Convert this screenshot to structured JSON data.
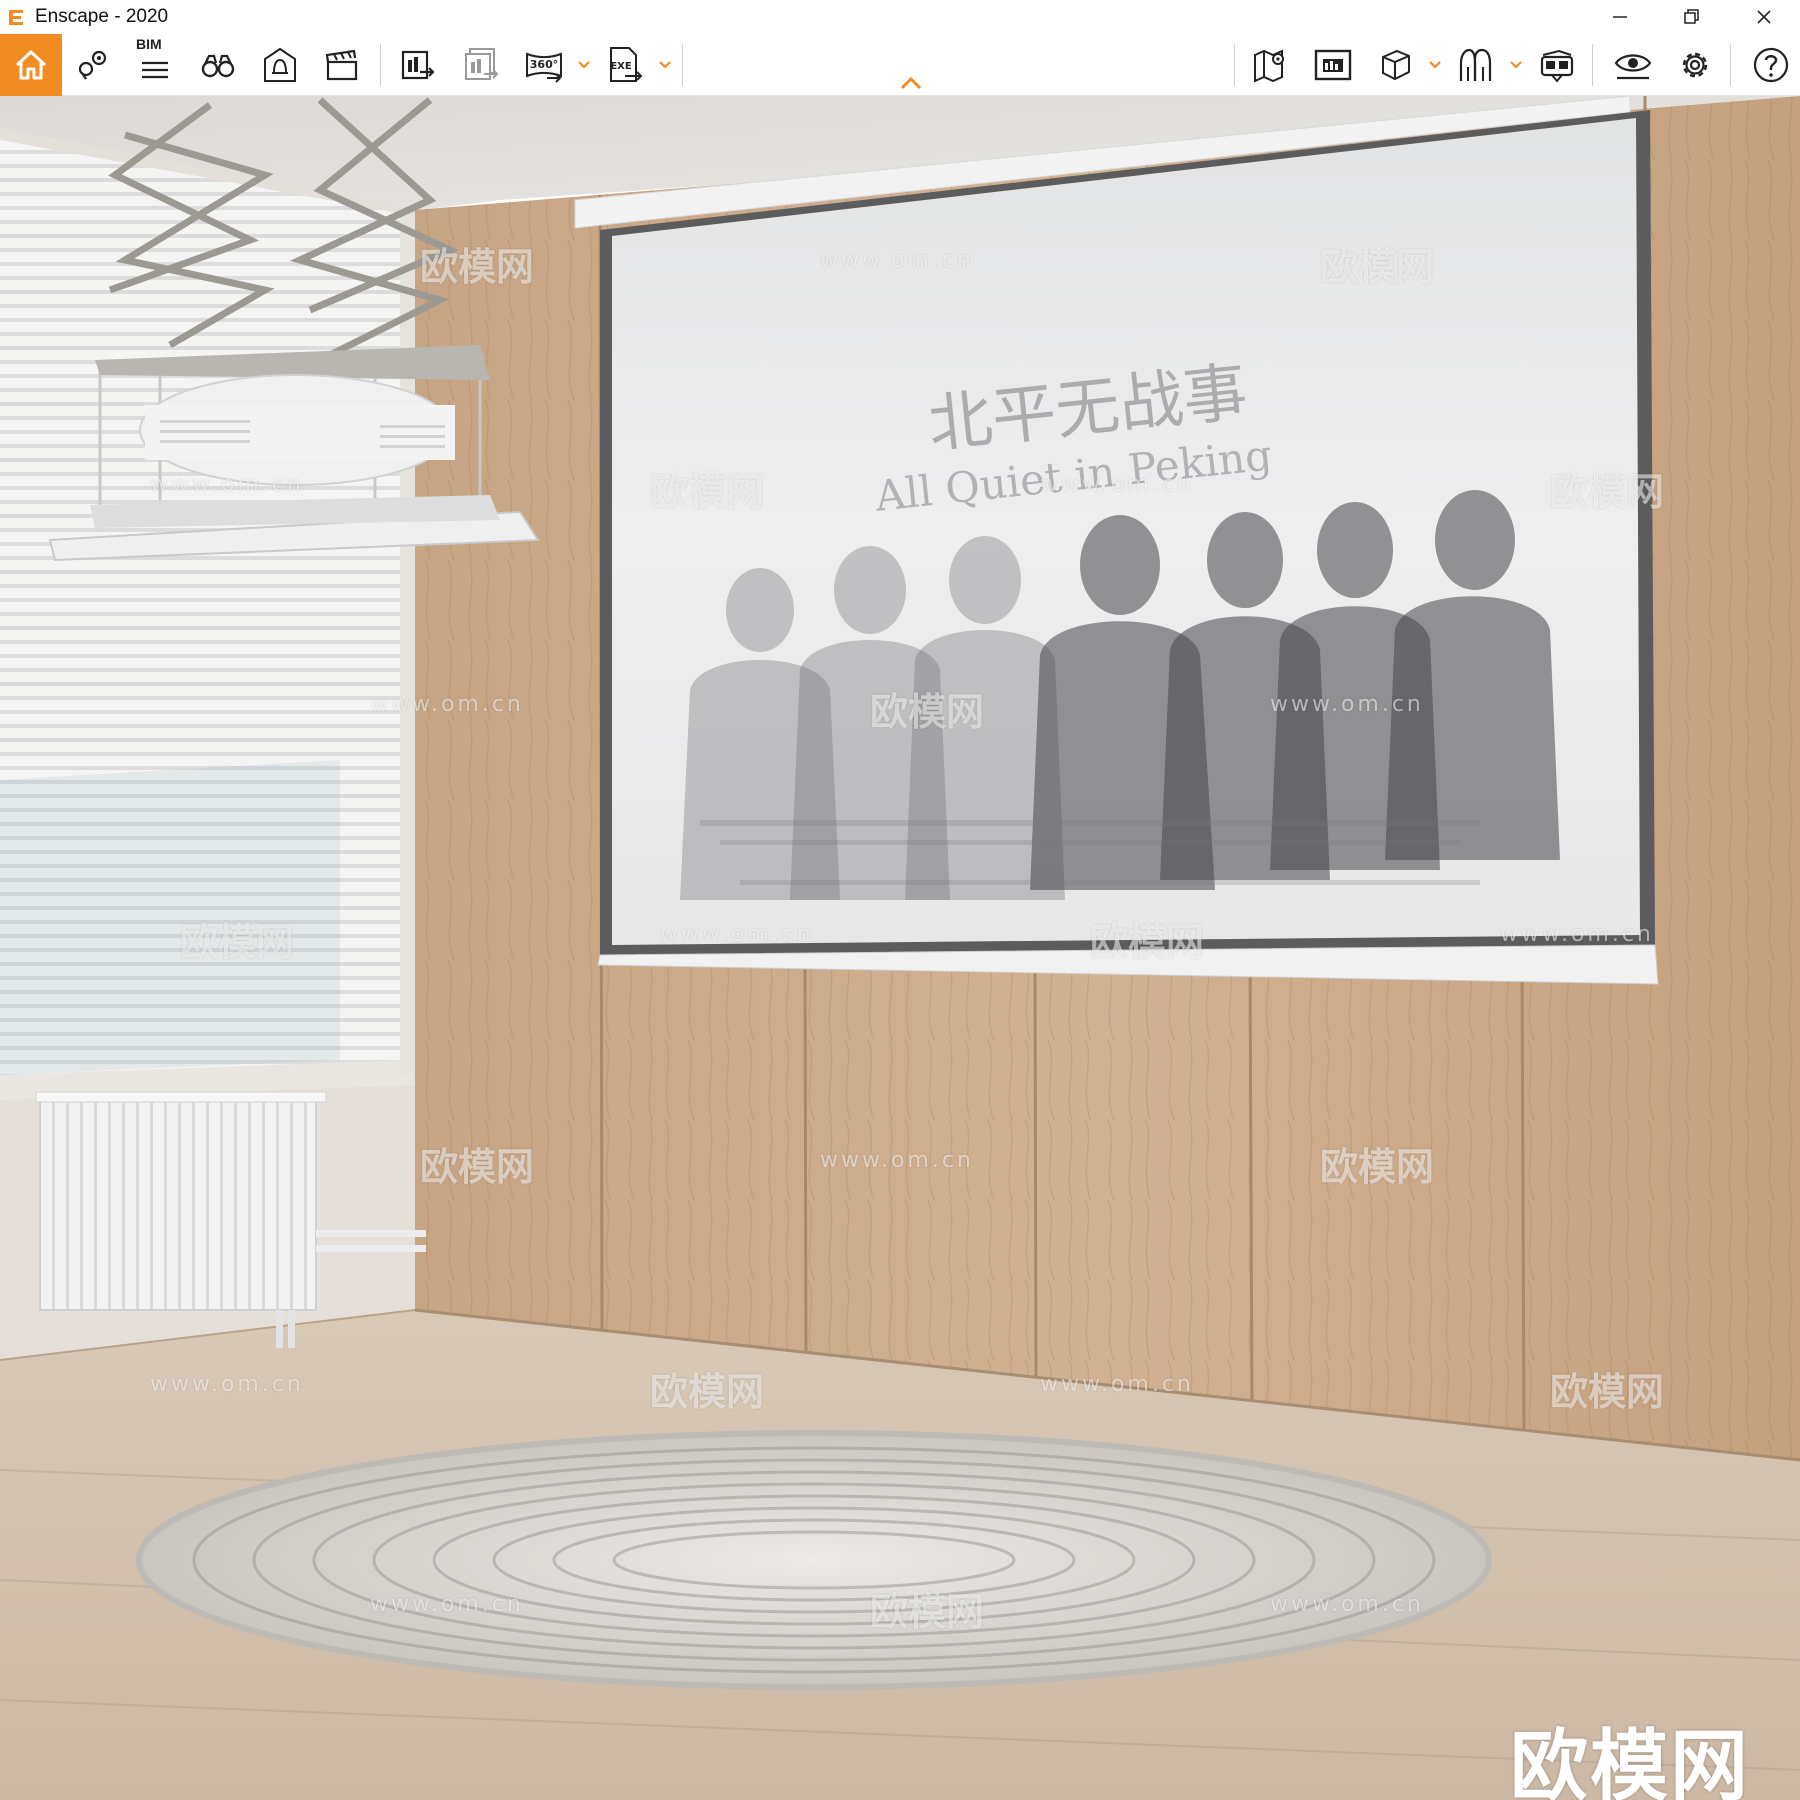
{
  "window": {
    "title": "Enscape - 2020",
    "controls": [
      "minimize",
      "restore",
      "close"
    ]
  },
  "toolbar": {
    "accent_color": "#f28c22",
    "bim_label": "BIM",
    "items": [
      {
        "name": "home-icon",
        "active": true
      },
      {
        "name": "location-pin-icon"
      },
      {
        "name": "bim-info-icon"
      },
      {
        "name": "binoculars-icon"
      },
      {
        "name": "bell-house-icon"
      },
      {
        "name": "clapperboard-icon"
      },
      {
        "name": "export-screenshot-icon"
      },
      {
        "name": "batch-render-icon"
      },
      {
        "name": "panorama-360-icon",
        "label": "360°",
        "has_dropdown": true
      },
      {
        "name": "exe-export-icon",
        "label": "EXE",
        "has_dropdown": true
      },
      {
        "name": "map-pin-icon"
      },
      {
        "name": "asset-library-icon"
      },
      {
        "name": "cube-view-icon",
        "has_dropdown": true
      },
      {
        "name": "views-icon",
        "has_dropdown": true
      },
      {
        "name": "vr-headset-icon"
      },
      {
        "name": "visual-settings-eye-icon"
      },
      {
        "name": "settings-gear-icon"
      },
      {
        "name": "help-icon"
      }
    ]
  },
  "viewport": {
    "scene": "interior render: home theater room with motorized projector lift, pull-down projection screen, wood wall panels, window blinds, radiator and round rug",
    "screen_poster": {
      "title_cn": "北平无战事",
      "title_en": "All Quiet in Peking"
    },
    "watermark_brand": "欧模网",
    "watermark_url": "www.om.cn",
    "corner_watermark": "欧模网"
  }
}
